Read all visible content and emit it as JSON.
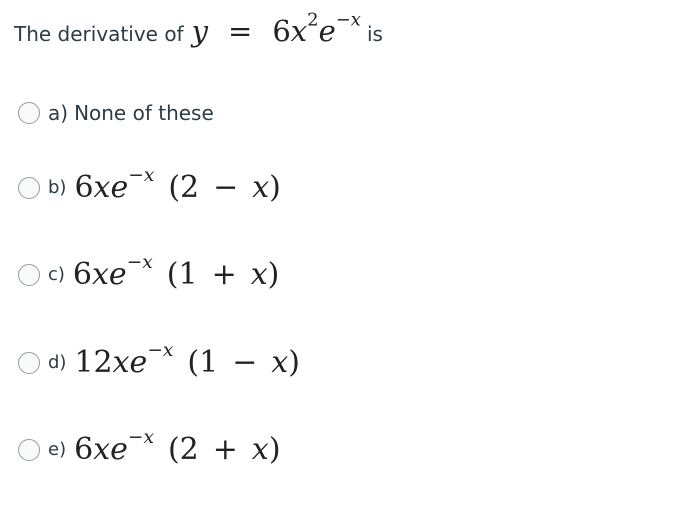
{
  "question": {
    "prefix": "The derivative of",
    "lhs_var": "y",
    "equals": "=",
    "rhs": {
      "coef": "6",
      "var": "x",
      "exp": "2",
      "base": "e",
      "exp2": "−x"
    },
    "suffix": "is"
  },
  "options": [
    {
      "label": "a)",
      "text": "None of these"
    },
    {
      "label": "b)",
      "coef": "6",
      "var": "xe",
      "exp": "−x",
      "open": "(2",
      "op": "−",
      "close_var": "x",
      "close": ")"
    },
    {
      "label": "c)",
      "coef": "6",
      "var": "xe",
      "exp": "−x",
      "open": "(1",
      "op": "+",
      "close_var": "x",
      "close": ")"
    },
    {
      "label": "d)",
      "coef": "12",
      "var": "xe",
      "exp": "−x",
      "open": "(1",
      "op": "−",
      "close_var": "x",
      "close": ")"
    },
    {
      "label": "e)",
      "coef": "6",
      "var": "xe",
      "exp": "−x",
      "open": "(2",
      "op": "+",
      "close_var": "x",
      "close": ")"
    }
  ]
}
